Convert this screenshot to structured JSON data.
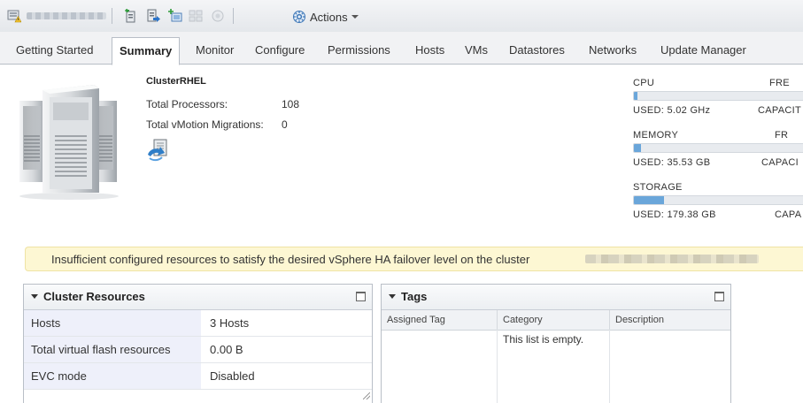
{
  "toolbar": {
    "actions_label": "Actions"
  },
  "tabs": [
    {
      "label": "Getting Started"
    },
    {
      "label": "Summary"
    },
    {
      "label": "Monitor"
    },
    {
      "label": "Configure"
    },
    {
      "label": "Permissions"
    },
    {
      "label": "Hosts"
    },
    {
      "label": "VMs"
    },
    {
      "label": "Datastores"
    },
    {
      "label": "Networks"
    },
    {
      "label": "Update Manager"
    }
  ],
  "summary": {
    "cluster_name": "ClusterRHEL",
    "total_processors_label": "Total Processors:",
    "total_processors_value": "108",
    "vmotion_label": "Total vMotion Migrations:",
    "vmotion_value": "0"
  },
  "meters": [
    {
      "label": "CPU",
      "right_label": "FRE",
      "used": "USED: 5.02 GHz",
      "capacity": "CAPACIT",
      "fill_fraction": 0.02
    },
    {
      "label": "MEMORY",
      "right_label": "FR",
      "used": "USED: 35.53 GB",
      "capacity": "CAPACI",
      "fill_fraction": 0.04
    },
    {
      "label": "STORAGE",
      "right_label": "",
      "used": "USED: 179.38 GB",
      "capacity": "CAPA",
      "fill_fraction": 0.17
    }
  ],
  "warning": {
    "text": "Insufficient configured resources to satisfy the desired vSphere HA failover level on the cluster"
  },
  "cluster_resources": {
    "title": "Cluster Resources",
    "rows": [
      {
        "key": "Hosts",
        "value": "3 Hosts"
      },
      {
        "key": "Total virtual flash resources",
        "value": "0.00 B"
      },
      {
        "key": "EVC mode",
        "value": "Disabled"
      }
    ]
  },
  "tags": {
    "title": "Tags",
    "columns": [
      "Assigned Tag",
      "Category",
      "Description"
    ],
    "empty_message": "This list is empty."
  },
  "colors": {
    "accent_blue": "#6aa6da",
    "warning_bg": "#fdf7d3",
    "key_cell_bg": "#eef0fa"
  }
}
